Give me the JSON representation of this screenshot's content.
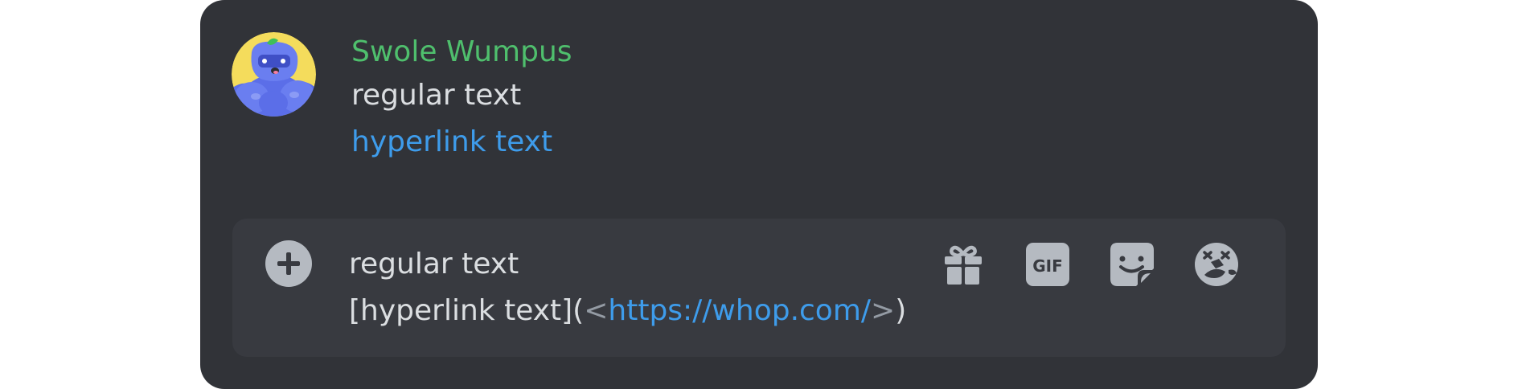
{
  "message": {
    "username": "Swole Wumpus",
    "lines": [
      "regular text",
      "hyperlink text"
    ]
  },
  "composer": {
    "line1": "regular text",
    "line2": {
      "prefix": "[hyperlink text](",
      "open_angle": "<",
      "url": "https://whop.com/",
      "close_angle": ">",
      "suffix": ")"
    },
    "buttons": {
      "attach": "plus-circle-icon",
      "gift": "gift-icon",
      "gif": "GIF",
      "sticker": "sticker-icon",
      "emoji": "emoji-icon"
    }
  },
  "colors": {
    "background": "#313338",
    "composer": "#383a40",
    "username": "#4fbf6d",
    "text": "#dbdee1",
    "link": "#3e9ceb",
    "icon": "#b5bac1"
  }
}
